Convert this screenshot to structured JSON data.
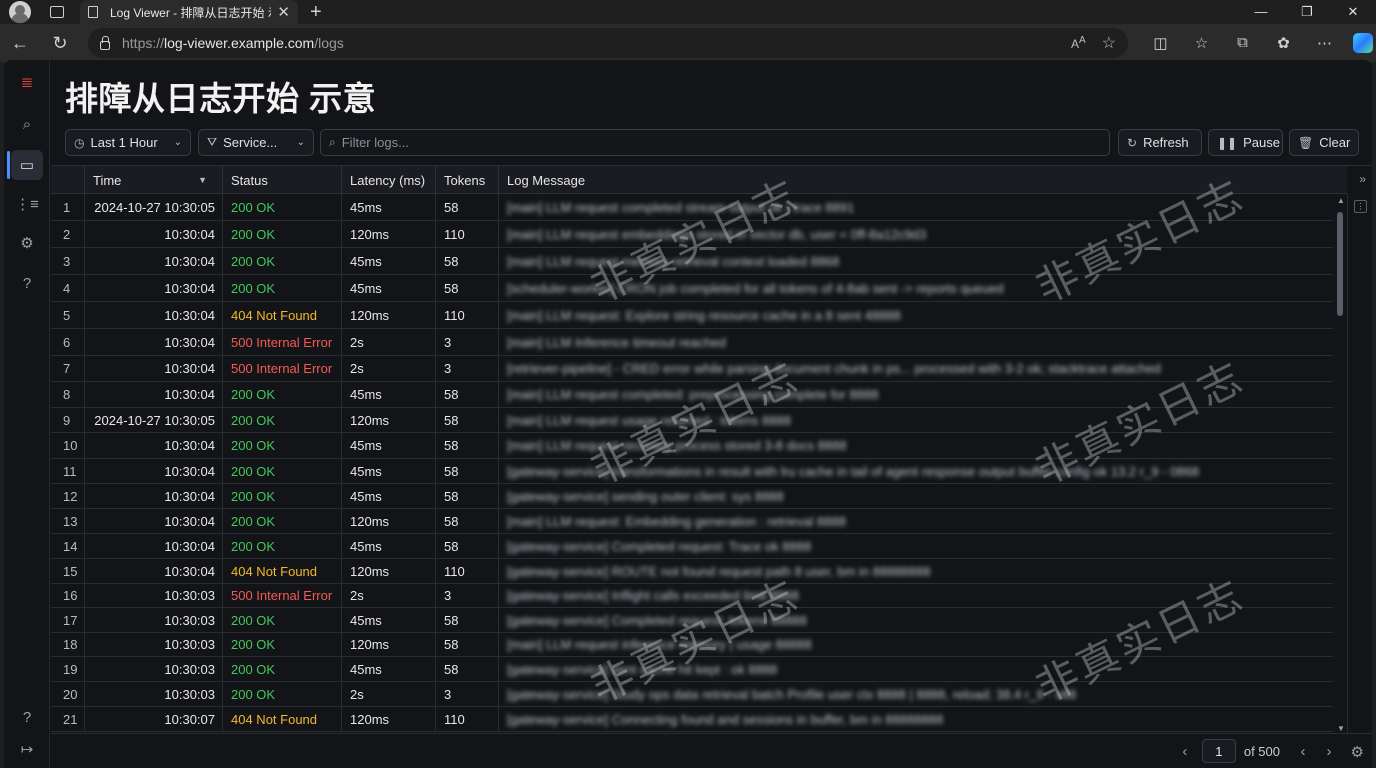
{
  "browser": {
    "tab_title": "Log Viewer - 排障从日志开始 示意",
    "url_prefix": "https://",
    "url_host": "log-viewer.example.com",
    "url_path": "/logs"
  },
  "app": {
    "title": "排障从日志开始 示意",
    "toolbar": {
      "time_range": "Last 1 Hour",
      "service": "Service...",
      "filter_placeholder": "Filter logs...",
      "refresh_label": "Refresh",
      "pause_label": "Pause",
      "clear_label": "Clear"
    },
    "columns": [
      "Time",
      "Status",
      "Latency (ms)",
      "Tokens",
      "Log Message"
    ],
    "rows": [
      {
        "n": "1",
        "time": "2024-10-27 10:30:05",
        "status": "200 OK",
        "kind": "ok",
        "latency": "45ms",
        "tokens": "58",
        "msg": "[main] LLM request completed stream output ok | trace 8891"
      },
      {
        "n": "2",
        "time": "10:30:04",
        "status": "200 OK",
        "kind": "ok",
        "latency": "120ms",
        "tokens": "110",
        "msg": "[main] LLM request embeddings stored in vector db, user = 0ff-8a12c9d3"
      },
      {
        "n": "3",
        "time": "10:30:04",
        "status": "200 OK",
        "kind": "ok",
        "latency": "45ms",
        "tokens": "58",
        "msg": "[main] LLM request memory retrieval context loaded 8868"
      },
      {
        "n": "4",
        "time": "10:30:04",
        "status": "200 OK",
        "kind": "ok",
        "latency": "45ms",
        "tokens": "58",
        "msg": "[scheduler-worker] CRON job completed for all tokens of 4-8ab sent -> reports queued"
      },
      {
        "n": "5",
        "time": "10:30:04",
        "status": "404 Not Found",
        "kind": "nf",
        "latency": "120ms",
        "tokens": "110",
        "msg": "[main] LLM request: Explore string resource cache in a 8 sent 48888"
      },
      {
        "n": "6",
        "time": "10:30:04",
        "status": "500 Internal Error",
        "kind": "err",
        "latency": "2s",
        "tokens": "3",
        "msg": "[main] LLM Inference timeout reached"
      },
      {
        "n": "7",
        "time": "10:30:04",
        "status": "500 Internal Error",
        "kind": "err",
        "latency": "2s",
        "tokens": "3",
        "msg": "[retriever-pipeline] - CRED error while parsing document chunk in ps... processed with 3-2 ok; stacktrace attached"
      },
      {
        "n": "8",
        "time": "10:30:04",
        "status": "200 OK",
        "kind": "ok",
        "latency": "45ms",
        "tokens": "58",
        "msg": "[main] LLM request completed: preprocessing complete for 8888"
      },
      {
        "n": "9",
        "time": "2024-10-27 10:30:05",
        "status": "200 OK",
        "kind": "ok",
        "latency": "120ms",
        "tokens": "58",
        "msg": "[main] LLM request usage returned : tokens 8888"
      },
      {
        "n": "10",
        "time": "10:30:04",
        "status": "200 OK",
        "kind": "ok",
        "latency": "45ms",
        "tokens": "58",
        "msg": "[main] LLM request recovery process stored 3-8 docs 8888"
      },
      {
        "n": "11",
        "time": "10:30:04",
        "status": "200 OK",
        "kind": "ok",
        "latency": "45ms",
        "tokens": "58",
        "msg": "[gateway-service] transformations in result with lru cache in tail of agent response output buffer config ok 13.2 r_9 - 0868"
      },
      {
        "n": "12",
        "time": "10:30:04",
        "status": "200 OK",
        "kind": "ok",
        "latency": "45ms",
        "tokens": "58",
        "msg": "[gateway-service] sending outer client: sys 8888"
      },
      {
        "n": "13",
        "time": "10:30:04",
        "status": "200 OK",
        "kind": "ok",
        "latency": "120ms",
        "tokens": "58",
        "msg": "[main] LLM request: Embedding generation : retrieval 8888"
      },
      {
        "n": "14",
        "time": "10:30:04",
        "status": "200 OK",
        "kind": "ok",
        "latency": "45ms",
        "tokens": "58",
        "msg": "[gateway-service] Completed request: Trace ok 8888"
      },
      {
        "n": "15",
        "time": "10:30:04",
        "status": "404 Not Found",
        "kind": "nf",
        "latency": "120ms",
        "tokens": "110",
        "msg": "[gateway-service] ROUTE not found request path 8 user, bm in 88888888"
      },
      {
        "n": "16",
        "time": "10:30:03",
        "status": "500 Internal Error",
        "kind": "err",
        "latency": "2s",
        "tokens": "3",
        "msg": "[gateway-service] Inflight calls exceeded limit 8888"
      },
      {
        "n": "17",
        "time": "10:30:03",
        "status": "200 OK",
        "kind": "ok",
        "latency": "45ms",
        "tokens": "58",
        "msg": "[gateway-service] Completed request: tokens 88888"
      },
      {
        "n": "18",
        "time": "10:30:03",
        "status": "200 OK",
        "kind": "ok",
        "latency": "120ms",
        "tokens": "58",
        "msg": "[main] LLM request inference memory | usage 88888"
      },
      {
        "n": "19",
        "time": "10:30:03",
        "status": "200 OK",
        "kind": "ok",
        "latency": "45ms",
        "tokens": "58",
        "msg": "[gateway-service] sent cache hit kept : ok 8888"
      },
      {
        "n": "20",
        "time": "10:30:03",
        "status": "200 OK",
        "kind": "ok",
        "latency": "2s",
        "tokens": "3",
        "msg": "[gateway-service] Study ops data retrieval batch Profile user ctx 8888 | 8888, reload; 38.4 r_9 - v88"
      },
      {
        "n": "21",
        "time": "10:30:07",
        "status": "404 Not Found",
        "kind": "nf",
        "latency": "120ms",
        "tokens": "110",
        "msg": "[gateway-service] Connecting found and sessions in buffer, bm in 88888888"
      }
    ],
    "watermark": "非真实日志",
    "pager": {
      "page": "1",
      "of": "of 500"
    },
    "colors": {
      "ok": "#43c85a",
      "not_found": "#f2b92d",
      "error": "#f25b55",
      "accent": "#4a90ff"
    }
  }
}
